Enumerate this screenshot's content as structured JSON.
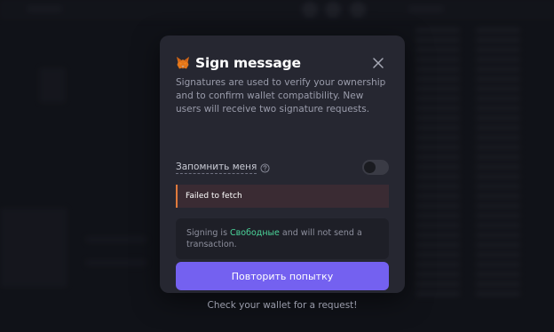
{
  "modal": {
    "title": "Sign message",
    "description": "Signatures are used to verify your ownership and to confirm wallet compatibility. New users will receive two signature requests.",
    "remember_label": "Запомнить меня",
    "remember_enabled": false,
    "error_text": "Failed to fetch",
    "info_prefix": "Signing is ",
    "info_highlight": "Свободные",
    "info_suffix": " and will not send a transaction.",
    "retry_label": "Повторить попытку",
    "footer_text": "Check your wallet for a request!",
    "icons": {
      "brand": "metamask-fox-icon",
      "close": "close-icon",
      "help": "help-circle-icon"
    },
    "colors": {
      "accent": "#7461f0",
      "highlight": "#4bd49a",
      "error_border": "#e07b3c"
    }
  }
}
